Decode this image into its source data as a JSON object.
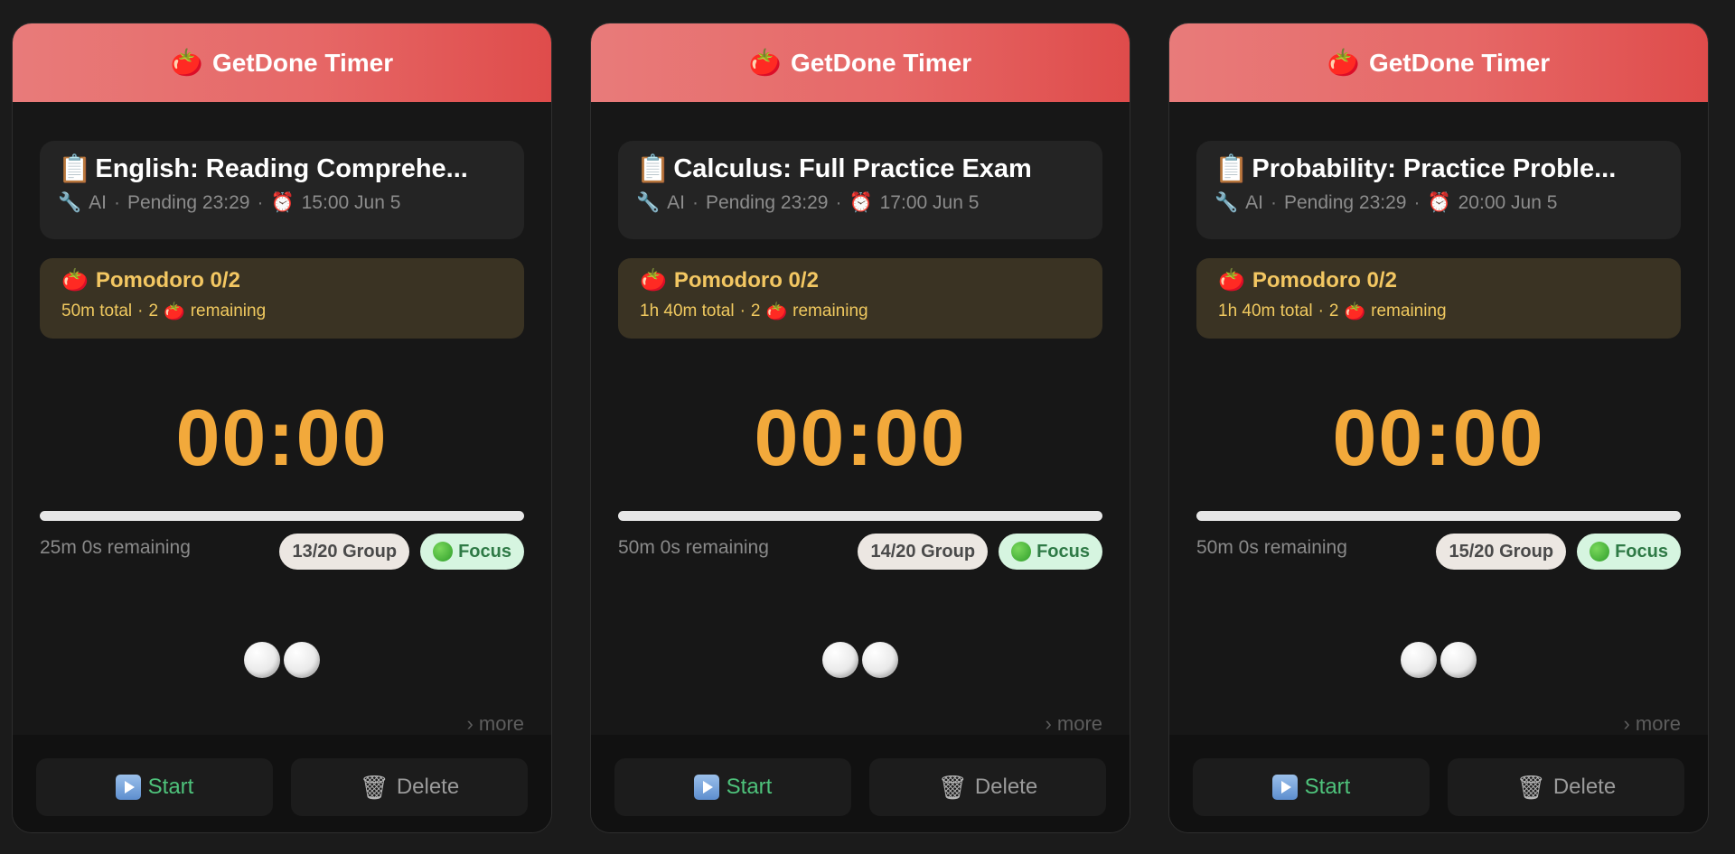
{
  "cards": [
    {
      "header": {
        "icon": "tomato-icon",
        "emoji": "🍅",
        "title": "GetDone Timer"
      },
      "task": {
        "emoji": "📋",
        "title": "English: Reading Comprehe...",
        "tool_emoji": "🔧",
        "tool": "AI",
        "status": "Pending 23:29",
        "alarm_emoji": "⏰",
        "due": "15:00 Jun 5"
      },
      "pomodoro": {
        "emoji": "🍅",
        "title": "Pomodoro 0/2",
        "total": "50m total",
        "remaining_count": "2",
        "remaining_label": "remaining"
      },
      "timer": "00:00",
      "progress": 0,
      "remaining_text": "25m 0s remaining",
      "group_badge": "13/20 Group",
      "focus_badge": "Focus",
      "more": "› more",
      "buttons": {
        "start": "Start",
        "delete": "Delete"
      }
    },
    {
      "header": {
        "icon": "tomato-icon",
        "emoji": "🍅",
        "title": "GetDone Timer"
      },
      "task": {
        "emoji": "📋",
        "title": "Calculus: Full Practice Exam",
        "tool_emoji": "🔧",
        "tool": "AI",
        "status": "Pending 23:29",
        "alarm_emoji": "⏰",
        "due": "17:00 Jun 5"
      },
      "pomodoro": {
        "emoji": "🍅",
        "title": "Pomodoro 0/2",
        "total": "1h 40m total",
        "remaining_count": "2",
        "remaining_label": "remaining"
      },
      "timer": "00:00",
      "progress": 0,
      "remaining_text": "50m 0s remaining",
      "group_badge": "14/20 Group",
      "focus_badge": "Focus",
      "more": "› more",
      "buttons": {
        "start": "Start",
        "delete": "Delete"
      }
    },
    {
      "header": {
        "icon": "tomato-icon",
        "emoji": "🍅",
        "title": "GetDone Timer"
      },
      "task": {
        "emoji": "📋",
        "title": "Probability: Practice Proble...",
        "tool_emoji": "🔧",
        "tool": "AI",
        "status": "Pending 23:29",
        "alarm_emoji": "⏰",
        "due": "20:00 Jun 5"
      },
      "pomodoro": {
        "emoji": "🍅",
        "title": "Pomodoro 0/2",
        "total": "1h 40m total",
        "remaining_count": "2",
        "remaining_label": "remaining"
      },
      "timer": "00:00",
      "progress": 0,
      "remaining_text": "50m 0s remaining",
      "group_badge": "15/20 Group",
      "focus_badge": "Focus",
      "more": "› more",
      "buttons": {
        "start": "Start",
        "delete": "Delete"
      }
    }
  ],
  "colors": {
    "header_start": "#e87b7a",
    "header_end": "#df4c4b",
    "timer": "#f2a93b",
    "start_text": "#4ec27b",
    "pomodoro_text": "#f3c762"
  },
  "dot_separator": "·"
}
